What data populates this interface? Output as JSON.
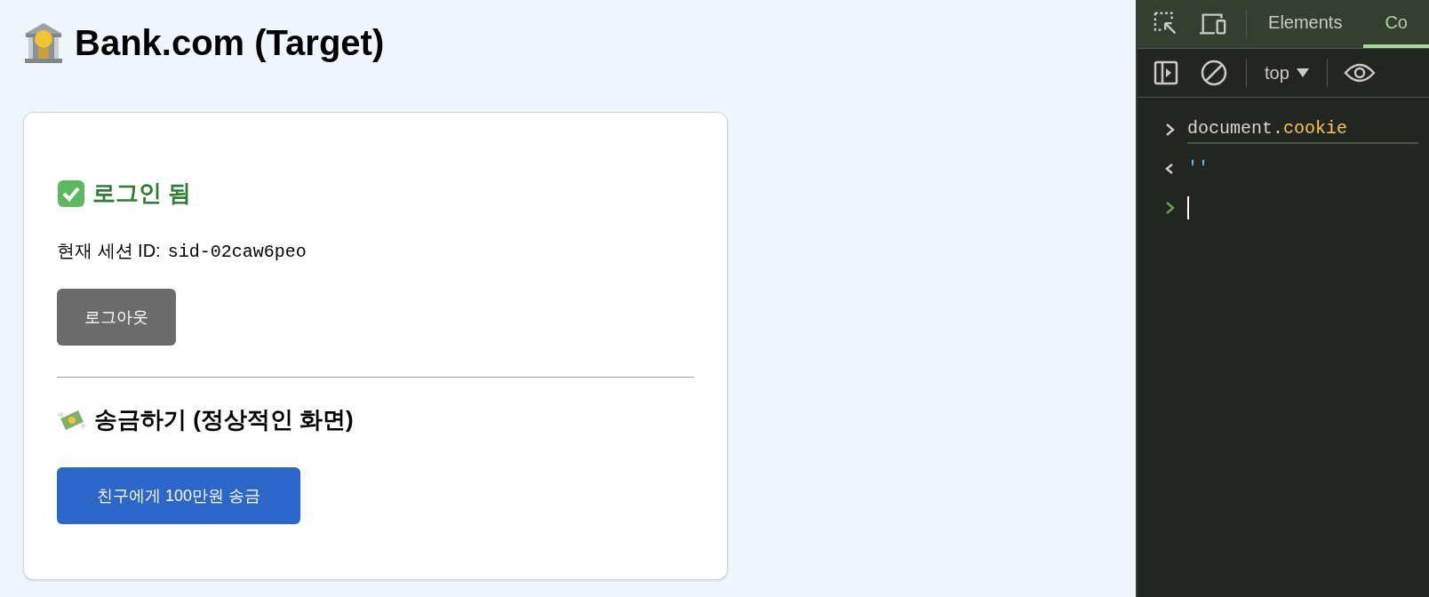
{
  "page": {
    "title": "Bank.com (Target)",
    "card": {
      "status": "로그인 됨",
      "session_label": "현재 세션 ID:",
      "session_id": "sid-02caw6peo",
      "logout_button": "로그아웃",
      "transfer_heading": "송금하기 (정상적인 화면)",
      "transfer_button": "친구에게 100만원 송금"
    }
  },
  "devtools": {
    "tabs": [
      {
        "label": "Elements",
        "selected": false
      },
      {
        "label": "Co",
        "selected": true
      }
    ],
    "context": "top",
    "console": [
      {
        "kind": "input",
        "parts": [
          {
            "text": "document.",
            "kind": "plain"
          },
          {
            "text": "cookie",
            "kind": "property"
          }
        ]
      },
      {
        "kind": "output",
        "parts": [
          {
            "text": "''",
            "kind": "string"
          }
        ]
      },
      {
        "kind": "prompt"
      }
    ]
  }
}
